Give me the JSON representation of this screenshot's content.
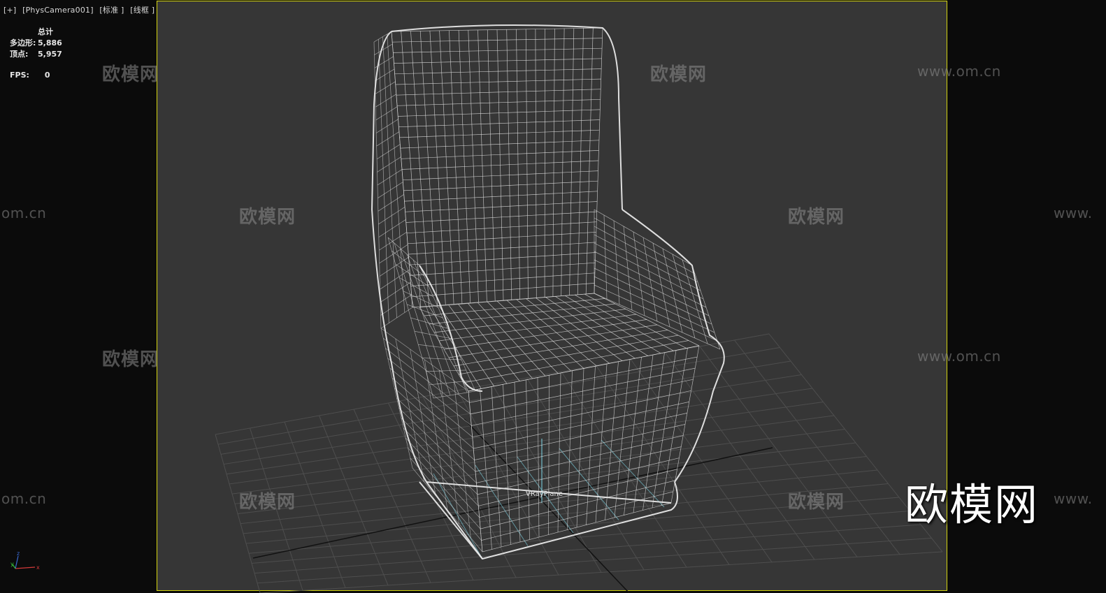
{
  "viewport": {
    "labels": [
      "[+]",
      "[PhysCamera001]",
      "[标准 ]",
      "[线框 ]"
    ]
  },
  "stats": {
    "header": "总计",
    "polygons_label": "多边形:",
    "polygons_value": "5,886",
    "vertices_label": "顶点:",
    "vertices_value": "5,957",
    "fps_label": "FPS:",
    "fps_value": "0"
  },
  "object_label": "VRayPlane",
  "axis": {
    "x": "x",
    "y": "y",
    "z": "z"
  },
  "watermark": {
    "text": "欧模网",
    "url_left": "om.cn",
    "url_full": "www.om.cn",
    "url_right": "www."
  },
  "logo": "欧模网",
  "colors": {
    "background": "#0b0b0b",
    "viewport": "#363636",
    "safe_frame": "#d4d410",
    "wireframe": "#e8e8e8",
    "grid": "#4e4e4e",
    "vray_plane": "#7fd6e6"
  }
}
